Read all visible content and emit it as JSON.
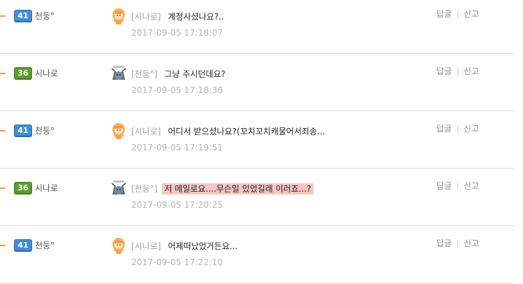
{
  "comments": [
    {
      "level": "41",
      "level_color": "#3f8fd6",
      "user": "천둥°",
      "avatar_icon": "blonde-girl-avatar-icon",
      "author": "[시나로]",
      "text": "계정사셨나요?..",
      "date": "2017-09-05 17:18:07",
      "reply": "답글",
      "report": "신고",
      "highlight": false
    },
    {
      "level": "36",
      "level_color": "#5a9f2d",
      "user": "시나로",
      "avatar_icon": "cat-avatar-icon",
      "author": "[천둥°]",
      "text": "그냥 주시던데요?",
      "date": "2017-09-05 17:18:38",
      "reply": "답글",
      "report": "신고",
      "highlight": false
    },
    {
      "level": "41",
      "level_color": "#3f8fd6",
      "user": "천둥°",
      "avatar_icon": "blonde-girl-avatar-icon",
      "author": "[시나로]",
      "text": "어디서 받으셨나요?(꼬치꼬치캐물어서죄송...",
      "date": "2017-09-05 17:19:51",
      "reply": "답글",
      "report": "신고",
      "highlight": false
    },
    {
      "level": "36",
      "level_color": "#5a9f2d",
      "user": "시나로",
      "avatar_icon": "cat-avatar-icon",
      "author": "[천둥°]",
      "text": "저 메일로요....무슨일 있었길래 이러죠...?",
      "date": "2017-09-05 17:20:25",
      "reply": "답글",
      "report": "신고",
      "highlight": true
    },
    {
      "level": "41",
      "level_color": "#3f8fd6",
      "user": "천둥°",
      "avatar_icon": "blonde-girl-avatar-icon",
      "author": "[시나로]",
      "text": "어제떠났었거든요...",
      "date": "2017-09-05 17:22:10",
      "reply": "답글",
      "report": "신고",
      "highlight": false
    }
  ]
}
